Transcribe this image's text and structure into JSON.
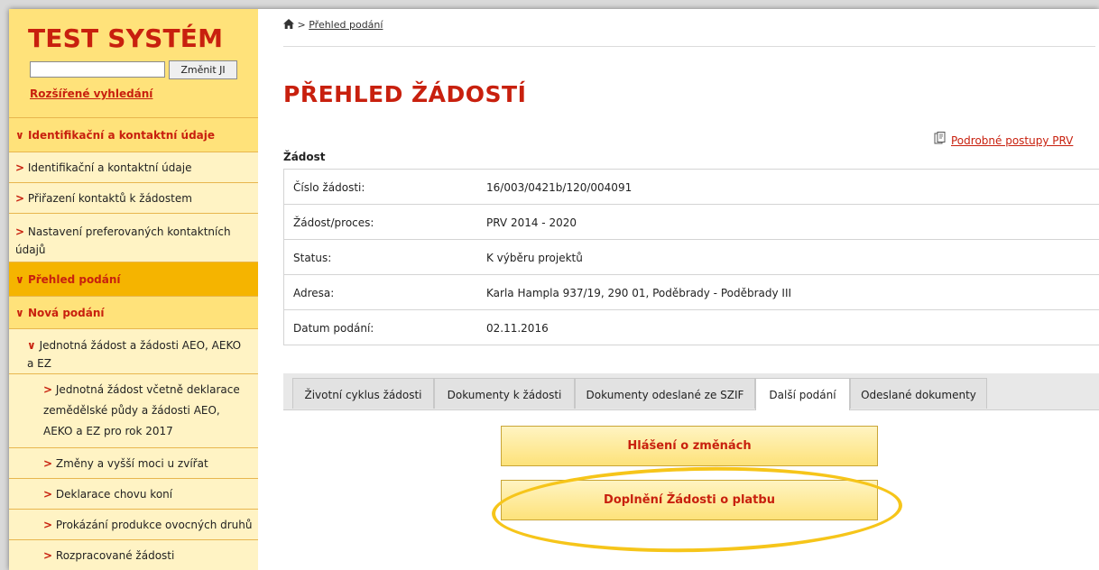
{
  "sidebar": {
    "logo": "TEST SYSTÉM",
    "search": {
      "value": "",
      "button": "Změnit JI"
    },
    "advanced_link": "Rozšířené vyhledání",
    "items": [
      {
        "label": "Identifikační a kontaktní údaje",
        "chevron": "∨"
      },
      {
        "label": "Identifikační a kontaktní údaje",
        "chevron": ">"
      },
      {
        "label": "Přiřazení kontaktů k žádostem",
        "chevron": ">"
      },
      {
        "label": "Nastavení preferovaných kontaktních údajů",
        "chevron": ">"
      },
      {
        "label": "Přehled podání",
        "chevron": "∨"
      },
      {
        "label": "Nová podání",
        "chevron": "∨"
      },
      {
        "label": "Jednotná žádost a žádosti AEO, AEKO a EZ",
        "chevron": "∨"
      },
      {
        "label": "Jednotná žádost včetně deklarace zemědělské půdy a žádosti AEO, AEKO a EZ pro rok 2017",
        "chevron": ">"
      },
      {
        "label": "Změny a vyšší moci u zvířat",
        "chevron": ">"
      },
      {
        "label": "Deklarace chovu koní",
        "chevron": ">"
      },
      {
        "label": "Prokázání produkce ovocných druhů",
        "chevron": ">"
      },
      {
        "label": "Rozpracované žádosti",
        "chevron": ">"
      }
    ]
  },
  "breadcrumb": {
    "separator": ">",
    "current": "Přehled podání"
  },
  "page_title": "PŘEHLED ŽÁDOSTÍ",
  "help_link": "Podrobné postupy PRV",
  "section_title": "Žádost",
  "info": [
    {
      "label": "Číslo žádosti:",
      "value": "16/003/0421b/120/004091"
    },
    {
      "label": "Žádost/proces:",
      "value": "PRV 2014 - 2020"
    },
    {
      "label": "Status:",
      "value": "K výběru projektů"
    },
    {
      "label": "Adresa:",
      "value": "Karla Hampla 937/19, 290 01, Poděbrady - Poděbrady III"
    },
    {
      "label": "Datum podání:",
      "value": "02.11.2016"
    }
  ],
  "tabs": [
    {
      "label": "Životní cyklus žádosti"
    },
    {
      "label": "Dokumenty k žádosti"
    },
    {
      "label": "Dokumenty odeslané ze SZIF"
    },
    {
      "label": "Další podání"
    },
    {
      "label": "Odeslané dokumenty"
    }
  ],
  "buttons": {
    "report_changes": "Hlášení o změnách",
    "payment_supplement": "Doplnění Žádosti o platbu"
  },
  "colors": {
    "accent": "#c8200e",
    "sidebar": "#ffe27a",
    "active": "#f5b400",
    "highlight": "#f6c51a"
  }
}
